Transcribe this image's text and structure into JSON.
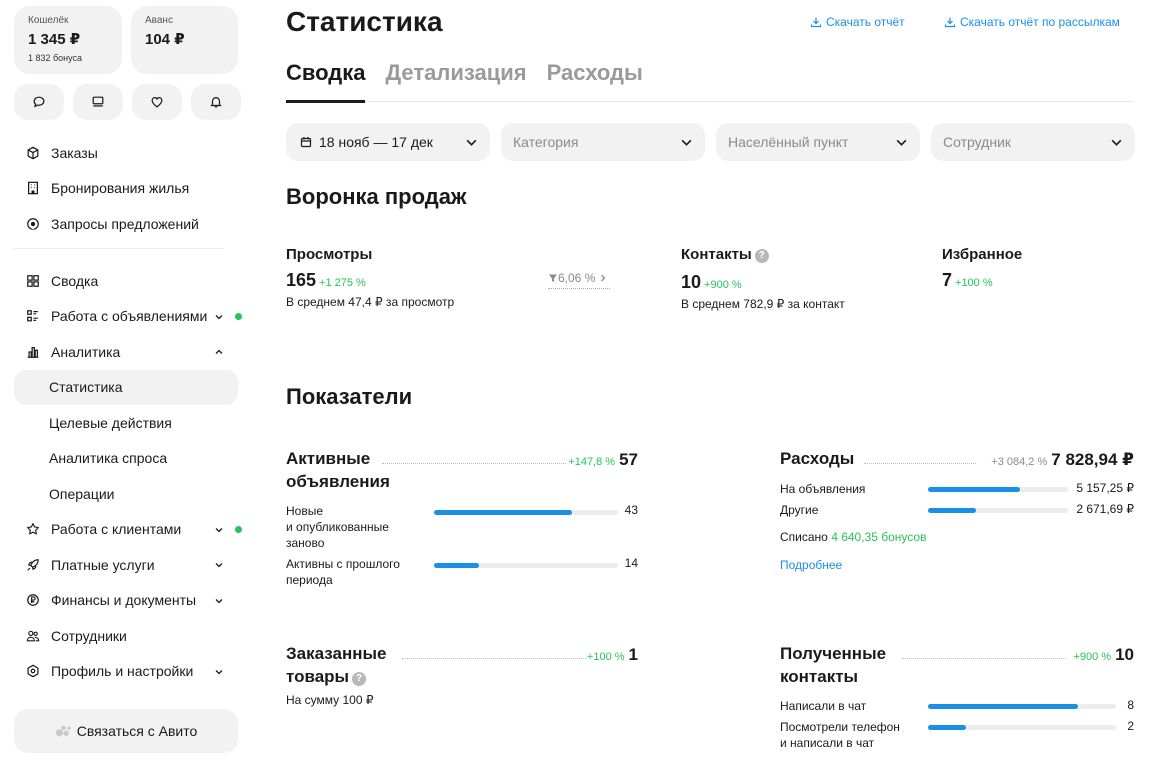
{
  "wallet": {
    "label": "Кошелёк",
    "value": "1 345 ₽",
    "bonus": "1 832 бонуса"
  },
  "advance": {
    "label": "Аванс",
    "value": "104 ₽"
  },
  "quick_actions": [
    "chat-icon",
    "monitor-icon",
    "heart-icon",
    "bell-icon"
  ],
  "nav_top": [
    {
      "label": "Заказы",
      "icon": "box-icon"
    },
    {
      "label": "Бронирования жилья",
      "icon": "building-icon"
    },
    {
      "label": "Запросы предложений",
      "icon": "request-icon"
    }
  ],
  "nav_main": [
    {
      "label": "Сводка",
      "icon": "grid-icon"
    },
    {
      "label": "Работа с объявлениями",
      "icon": "listing-icon",
      "chevron": "down",
      "dot": true
    },
    {
      "label": "Аналитика",
      "icon": "chart-icon",
      "chevron": "up"
    },
    {
      "label": "Статистика",
      "sub": true,
      "active": true
    },
    {
      "label": "Целевые действия",
      "sub": true
    },
    {
      "label": "Аналитика спроса",
      "sub": true
    },
    {
      "label": "Операции",
      "sub": true
    },
    {
      "label": "Работа с клиентами",
      "icon": "star-icon",
      "chevron": "down",
      "dot": true
    },
    {
      "label": "Платные услуги",
      "icon": "rocket-icon",
      "chevron": "down"
    },
    {
      "label": "Финансы и документы",
      "icon": "finance-icon",
      "chevron": "down"
    },
    {
      "label": "Сотрудники",
      "icon": "people-icon"
    },
    {
      "label": "Профиль и настройки",
      "icon": "settings-icon",
      "chevron": "down"
    }
  ],
  "contact_avito": "Связаться с Авито",
  "page_title": "Статистика",
  "download_report": "Скачать отчёт",
  "download_mailing": "Скачать отчёт по рассылкам",
  "tabs": [
    "Сводка",
    "Детализация",
    "Расходы"
  ],
  "filters": {
    "period": "18 нояб — 17 дек",
    "category": "Категория",
    "city": "Населённый пункт",
    "employee": "Сотрудник"
  },
  "funnel": {
    "title": "Воронка продаж",
    "views": {
      "label": "Просмотры",
      "value": "165",
      "delta": "+1 275 %",
      "sub": "В среднем 47,4 ₽ за просмотр"
    },
    "conversion": "6,06 %",
    "contacts": {
      "label": "Контакты",
      "value": "10",
      "delta": "+900 %",
      "sub": "В среднем 782,9 ₽ за контакт"
    },
    "favorites": {
      "label": "Избранное",
      "value": "7",
      "delta": "+100 %"
    }
  },
  "indicators": {
    "title": "Показатели",
    "active_listings": {
      "name_line1": "Активные",
      "name_line2": "объявления",
      "delta": "+147,8 %",
      "total": "57",
      "rows": [
        {
          "label": "Новые\nи опубликованные\nзаново",
          "value": "43",
          "fraction": 0.75
        },
        {
          "label": "Активны с прошлого\nпериода",
          "value": "14",
          "fraction": 0.245
        }
      ]
    },
    "expenses": {
      "name": "Расходы",
      "delta": "+3 084,2 %",
      "total": "7 828,94 ₽",
      "rows": [
        {
          "label": "На объявления",
          "value": "5 157,25 ₽",
          "fraction": 0.66
        },
        {
          "label": "Другие",
          "value": "2 671,69 ₽",
          "fraction": 0.34
        }
      ],
      "written_off_label": "Списано",
      "written_off_value": "4 640,35 бонусов",
      "more": "Подробнее"
    },
    "ordered_goods": {
      "name_line1": "Заказанные",
      "name_line2": "товары",
      "delta": "+100 %",
      "total": "1",
      "sub": "На сумму 100 ₽"
    },
    "received_contacts": {
      "name_line1": "Полученные",
      "name_line2": "контакты",
      "delta": "+900 %",
      "total": "10",
      "rows": [
        {
          "label": "Написали в чат",
          "value": "8",
          "fraction": 0.8
        },
        {
          "label": "Посмотрели телефон\nи написали в чат",
          "value": "2",
          "fraction": 0.2
        }
      ]
    }
  }
}
